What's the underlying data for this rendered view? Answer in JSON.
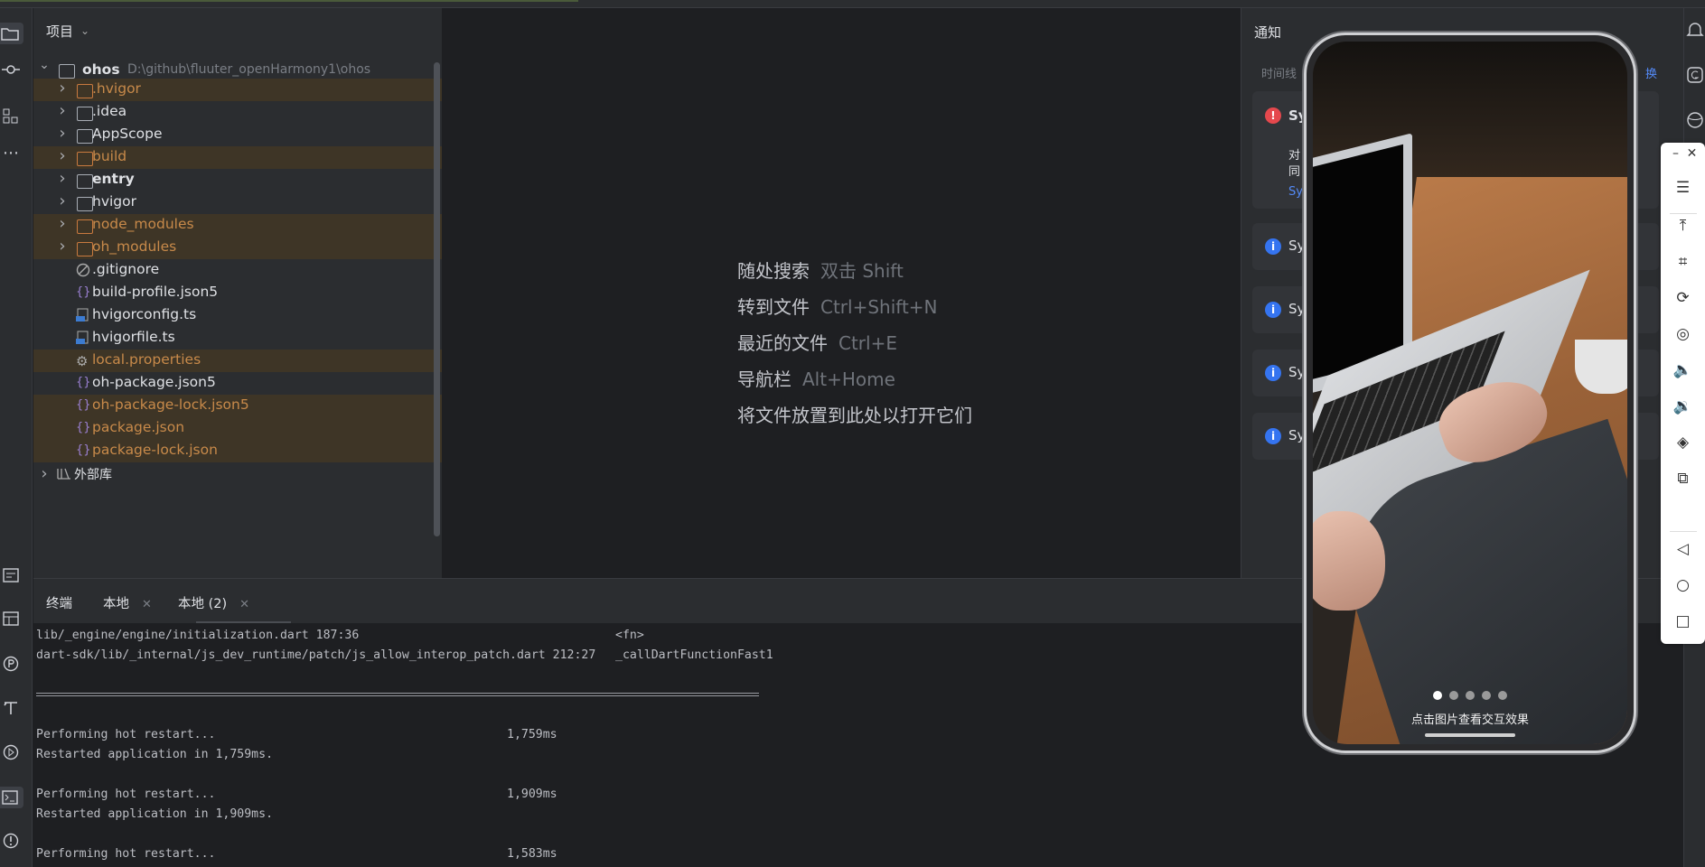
{
  "project": {
    "header": "项目",
    "root": {
      "name": "ohos",
      "path": "D:\\github\\fluuter_openHarmony1\\ohos"
    },
    "items": [
      {
        "label": ".hvigor",
        "type": "folder",
        "ignored": true
      },
      {
        "label": ".idea",
        "type": "folder",
        "ignored": false
      },
      {
        "label": "AppScope",
        "type": "folder",
        "ignored": false
      },
      {
        "label": "build",
        "type": "folder",
        "ignored": true
      },
      {
        "label": "entry",
        "type": "module",
        "ignored": false
      },
      {
        "label": "hvigor",
        "type": "folder",
        "ignored": false
      },
      {
        "label": "node_modules",
        "type": "folder",
        "ignored": true
      },
      {
        "label": "oh_modules",
        "type": "folder",
        "ignored": true
      },
      {
        "label": ".gitignore",
        "type": "gitignore",
        "ignored": false
      },
      {
        "label": "build-profile.json5",
        "type": "json",
        "ignored": false
      },
      {
        "label": "hvigorconfig.ts",
        "type": "ts",
        "ignored": false
      },
      {
        "label": "hvigorfile.ts",
        "type": "ts",
        "ignored": false
      },
      {
        "label": "local.properties",
        "type": "properties",
        "ignored": true
      },
      {
        "label": "oh-package.json5",
        "type": "json",
        "ignored": false
      },
      {
        "label": "oh-package-lock.json5",
        "type": "json",
        "ignored": true
      },
      {
        "label": "package.json",
        "type": "json",
        "ignored": true
      },
      {
        "label": "package-lock.json",
        "type": "json",
        "ignored": true
      }
    ],
    "external": "外部库"
  },
  "welcome": [
    {
      "label": "随处搜索",
      "key": "双击 Shift"
    },
    {
      "label": "转到文件",
      "key": "Ctrl+Shift+N"
    },
    {
      "label": "最近的文件",
      "key": "Ctrl+E"
    },
    {
      "label": "导航栏",
      "key": "Alt+Home"
    },
    {
      "label": "将文件放置到此处以打开它们",
      "key": ""
    }
  ],
  "notifications": {
    "title": "通知",
    "subtitle": "时间线",
    "cards": [
      {
        "title": "Sy",
        "level": "error",
        "body1": "对",
        "body2": "同",
        "link": "Sy"
      },
      {
        "title": "Sy",
        "level": "info"
      },
      {
        "title": "Sy",
        "level": "info"
      },
      {
        "title": "Sy",
        "level": "info"
      },
      {
        "title": "Sy",
        "level": "info"
      }
    ],
    "corner_link": "换"
  },
  "terminal": {
    "tabs": [
      {
        "label": "终端",
        "closable": false
      },
      {
        "label": "本地",
        "closable": true
      },
      {
        "label": "本地 (2)",
        "closable": true
      }
    ],
    "lines": [
      {
        "text": "lib/_engine/engine/initialization.dart 187:36",
        "right": "<fn>"
      },
      {
        "text": "dart-sdk/lib/_internal/js_dev_runtime/patch/js_allow_interop_patch.dart 212:27",
        "right": "_callDartFunctionFast1"
      },
      {
        "text": "Performing hot restart...",
        "right": "1,759ms"
      },
      {
        "text": "Restarted application in 1,759ms.",
        "right": ""
      },
      {
        "text": "Performing hot restart...",
        "right": "1,909ms"
      },
      {
        "text": "Restarted application in 1,909ms.",
        "right": ""
      },
      {
        "text": "Performing hot restart...",
        "right": "1,583ms"
      }
    ]
  },
  "phone": {
    "caption": "点击图片查看交互效果",
    "pages": 5,
    "current_page": 1
  },
  "colors": {
    "ignored_row": "#3e3526",
    "orange_text": "#c88a4a",
    "error": "#e5484d",
    "info": "#3574f0"
  }
}
